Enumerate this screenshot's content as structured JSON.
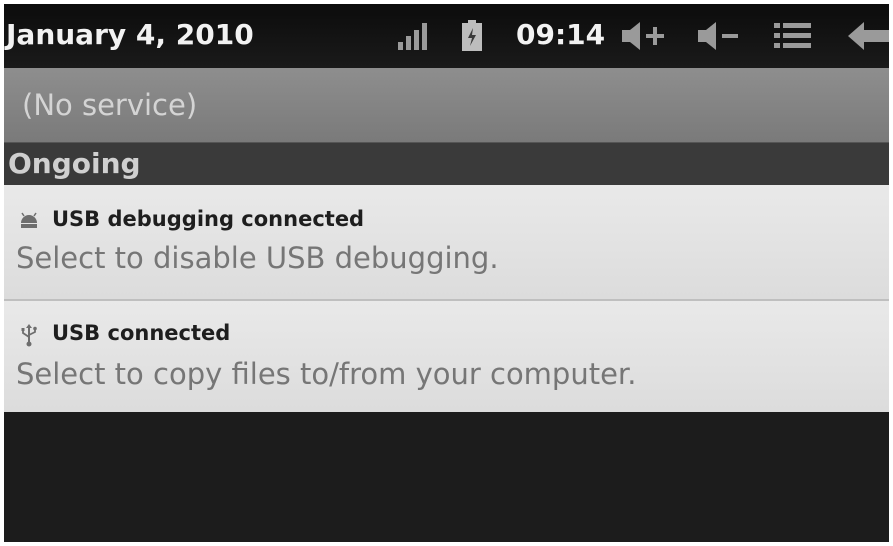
{
  "status_bar": {
    "date": "January 4, 2010",
    "time": "09:14",
    "icons": [
      "signal-icon",
      "battery-icon",
      "volume-up-icon",
      "volume-down-icon",
      "menu-icon",
      "back-icon"
    ]
  },
  "service": {
    "text": "(No service)"
  },
  "ongoing": {
    "header": "Ongoing",
    "items": [
      {
        "icon": "android-icon",
        "title": "USB debugging connected",
        "subtitle": "Select to disable USB debugging."
      },
      {
        "icon": "usb-icon",
        "title": "USB connected",
        "subtitle": "Select to copy files to/from your computer."
      }
    ]
  },
  "colors": {
    "status_bar_bg": "#111111",
    "service_band_bg": "#848484",
    "ongoing_header_bg": "#3a3a3a",
    "notification_bg": "#e2e2e2"
  }
}
